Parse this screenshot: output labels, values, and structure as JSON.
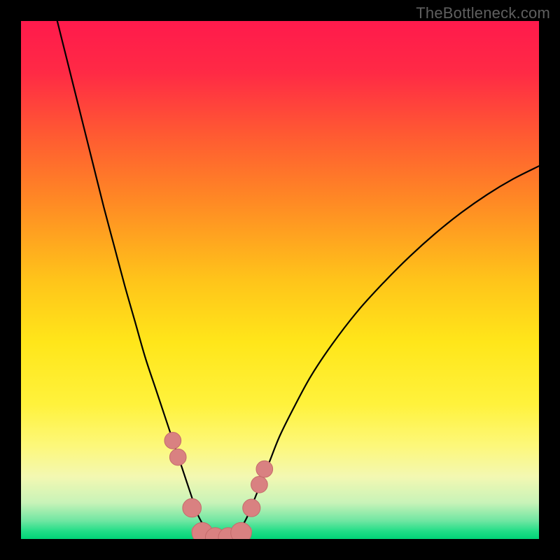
{
  "watermark": "TheBottleneck.com",
  "colors": {
    "black": "#000000",
    "curve": "#000000",
    "marker": "#d98181",
    "markerStroke": "#c46b6b"
  },
  "chart_data": {
    "type": "line",
    "title": "",
    "xlabel": "",
    "ylabel": "",
    "xlim": [
      0,
      100
    ],
    "ylim": [
      0,
      100
    ],
    "background_gradient_stops": [
      {
        "pos": 0.0,
        "color": "#ff1a4c"
      },
      {
        "pos": 0.1,
        "color": "#ff2a45"
      },
      {
        "pos": 0.22,
        "color": "#ff5a32"
      },
      {
        "pos": 0.35,
        "color": "#ff8a24"
      },
      {
        "pos": 0.5,
        "color": "#ffc41a"
      },
      {
        "pos": 0.62,
        "color": "#ffe61a"
      },
      {
        "pos": 0.74,
        "color": "#fff23c"
      },
      {
        "pos": 0.82,
        "color": "#fdf87a"
      },
      {
        "pos": 0.88,
        "color": "#f3f8b2"
      },
      {
        "pos": 0.93,
        "color": "#c8f3b8"
      },
      {
        "pos": 0.965,
        "color": "#6fe6a2"
      },
      {
        "pos": 0.985,
        "color": "#21de87"
      },
      {
        "pos": 1.0,
        "color": "#00d477"
      }
    ],
    "series": [
      {
        "name": "left-curve",
        "values": [
          {
            "x": 7.0,
            "y": 100.0
          },
          {
            "x": 8.5,
            "y": 94.0
          },
          {
            "x": 10.0,
            "y": 88.0
          },
          {
            "x": 12.0,
            "y": 80.0
          },
          {
            "x": 14.0,
            "y": 72.0
          },
          {
            "x": 16.0,
            "y": 64.0
          },
          {
            "x": 18.0,
            "y": 56.5
          },
          {
            "x": 20.0,
            "y": 49.0
          },
          {
            "x": 22.0,
            "y": 42.0
          },
          {
            "x": 24.0,
            "y": 35.0
          },
          {
            "x": 26.0,
            "y": 29.0
          },
          {
            "x": 28.0,
            "y": 23.0
          },
          {
            "x": 29.0,
            "y": 20.0
          },
          {
            "x": 30.0,
            "y": 17.0
          },
          {
            "x": 31.0,
            "y": 14.0
          },
          {
            "x": 32.0,
            "y": 11.0
          },
          {
            "x": 33.0,
            "y": 8.0
          },
          {
            "x": 34.0,
            "y": 5.0
          },
          {
            "x": 35.0,
            "y": 3.0
          },
          {
            "x": 36.0,
            "y": 1.5
          },
          {
            "x": 37.5,
            "y": 0.5
          },
          {
            "x": 39.0,
            "y": 0.0
          }
        ]
      },
      {
        "name": "right-curve",
        "values": [
          {
            "x": 39.0,
            "y": 0.0
          },
          {
            "x": 40.5,
            "y": 0.5
          },
          {
            "x": 42.0,
            "y": 1.5
          },
          {
            "x": 43.0,
            "y": 3.0
          },
          {
            "x": 44.0,
            "y": 5.0
          },
          {
            "x": 45.0,
            "y": 7.5
          },
          {
            "x": 46.0,
            "y": 10.0
          },
          {
            "x": 48.0,
            "y": 15.0
          },
          {
            "x": 50.0,
            "y": 20.0
          },
          {
            "x": 53.0,
            "y": 26.0
          },
          {
            "x": 56.0,
            "y": 31.5
          },
          {
            "x": 60.0,
            "y": 37.5
          },
          {
            "x": 65.0,
            "y": 44.0
          },
          {
            "x": 70.0,
            "y": 49.5
          },
          {
            "x": 75.0,
            "y": 54.5
          },
          {
            "x": 80.0,
            "y": 59.0
          },
          {
            "x": 85.0,
            "y": 63.0
          },
          {
            "x": 90.0,
            "y": 66.5
          },
          {
            "x": 95.0,
            "y": 69.5
          },
          {
            "x": 100.0,
            "y": 72.0
          }
        ]
      }
    ],
    "markers": [
      {
        "x": 29.3,
        "y": 19.0,
        "r": 1.6
      },
      {
        "x": 30.3,
        "y": 15.8,
        "r": 1.6
      },
      {
        "x": 33.0,
        "y": 6.0,
        "r": 1.8
      },
      {
        "x": 35.0,
        "y": 1.2,
        "r": 2.0
      },
      {
        "x": 37.5,
        "y": 0.3,
        "r": 1.9
      },
      {
        "x": 40.0,
        "y": 0.3,
        "r": 1.9
      },
      {
        "x": 42.5,
        "y": 1.2,
        "r": 2.0
      },
      {
        "x": 44.5,
        "y": 6.0,
        "r": 1.7
      },
      {
        "x": 46.0,
        "y": 10.5,
        "r": 1.6
      },
      {
        "x": 47.0,
        "y": 13.5,
        "r": 1.6
      }
    ],
    "trough_band": {
      "x0": 34.0,
      "x1": 43.5,
      "y": 0.6,
      "thickness": 2.2
    }
  }
}
